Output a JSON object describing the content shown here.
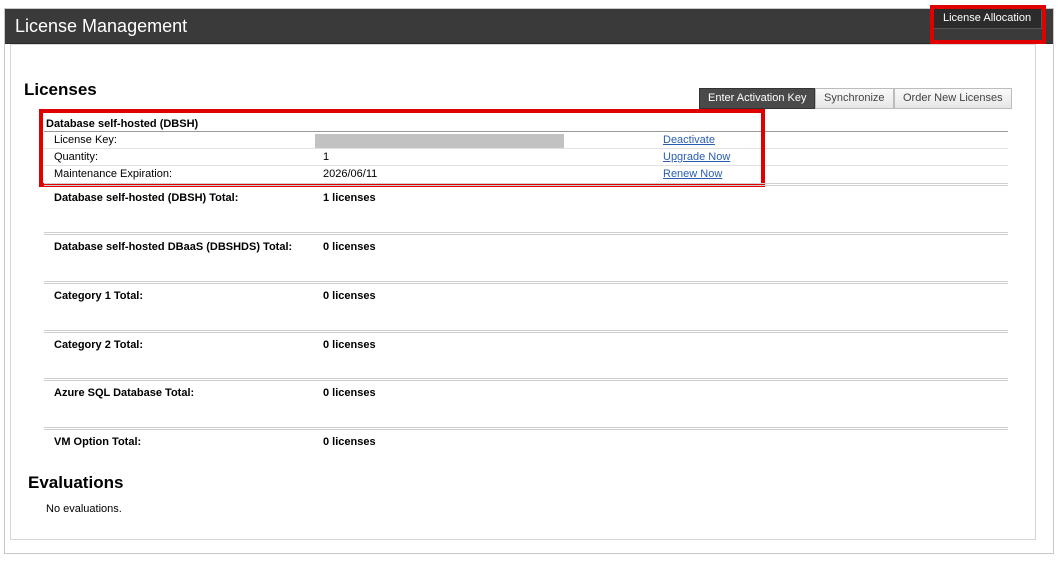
{
  "header": {
    "title": "License Management",
    "allocation_button": "License Allocation"
  },
  "licenses": {
    "heading": "Licenses",
    "toolbar": {
      "activation": "Enter Activation Key",
      "synchronize": "Synchronize",
      "order": "Order New Licenses"
    },
    "group": {
      "title": "Database self-hosted (DBSH)",
      "rows": [
        {
          "label": "License Key:",
          "value": "",
          "action": "Deactivate"
        },
        {
          "label": "Quantity:",
          "value": "1",
          "action": "Upgrade Now"
        },
        {
          "label": "Maintenance Expiration:",
          "value": "2026/06/11",
          "action": "Renew Now"
        }
      ]
    },
    "totals": [
      {
        "label": "Database self-hosted (DBSH) Total:",
        "value": "1 licenses"
      },
      {
        "label": "Database self-hosted DBaaS (DBSHDS) Total:",
        "value": "0 licenses"
      },
      {
        "label": "Category 1 Total:",
        "value": "0 licenses"
      },
      {
        "label": "Category 2 Total:",
        "value": "0 licenses"
      },
      {
        "label": "Azure SQL Database Total:",
        "value": "0 licenses"
      },
      {
        "label": "VM Option Total:",
        "value": "0 licenses"
      }
    ]
  },
  "evaluations": {
    "heading": "Evaluations",
    "empty_text": "No evaluations."
  },
  "colors": {
    "titlebar": "#3a3a3a",
    "highlight": "#e00000",
    "link": "#2a5db0",
    "key_mask": "#c2c2c2"
  }
}
